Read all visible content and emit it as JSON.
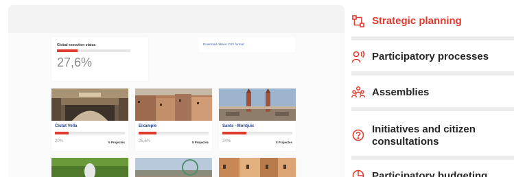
{
  "preview": {
    "status_card": {
      "title": "Global execution status",
      "value_text": "27,6%",
      "progress": 0.276
    },
    "download_link": "Download data in CSV format",
    "districts": [
      {
        "name": "Ciutat Vella",
        "pct_text": "20%",
        "progress": 0.2,
        "count_text": "5 Projectes"
      },
      {
        "name": "Eixample",
        "pct_text": "25,6%",
        "progress": 0.256,
        "count_text": "8 Projectes"
      },
      {
        "name": "Sants - Montjuïc",
        "pct_text": "34%",
        "progress": 0.34,
        "count_text": "5 Projectes"
      }
    ]
  },
  "menu": {
    "items": [
      {
        "label": "Strategic planning",
        "icon": "strategic-planning-icon",
        "active": true
      },
      {
        "label": "Participatory processes",
        "icon": "participatory-processes-icon",
        "active": false
      },
      {
        "label": "Assemblies",
        "icon": "assemblies-icon",
        "active": false
      },
      {
        "label": "Initiatives and citizen",
        "label_line2": "consultations",
        "icon": "initiatives-icon",
        "active": false
      },
      {
        "label": "Participatory budgeting",
        "icon": "budgeting-icon",
        "active": false
      }
    ]
  },
  "colors": {
    "accent": "#e03a2e",
    "link": "#3a5ba8",
    "district_name": "#27458c",
    "divider": "#ececec"
  }
}
